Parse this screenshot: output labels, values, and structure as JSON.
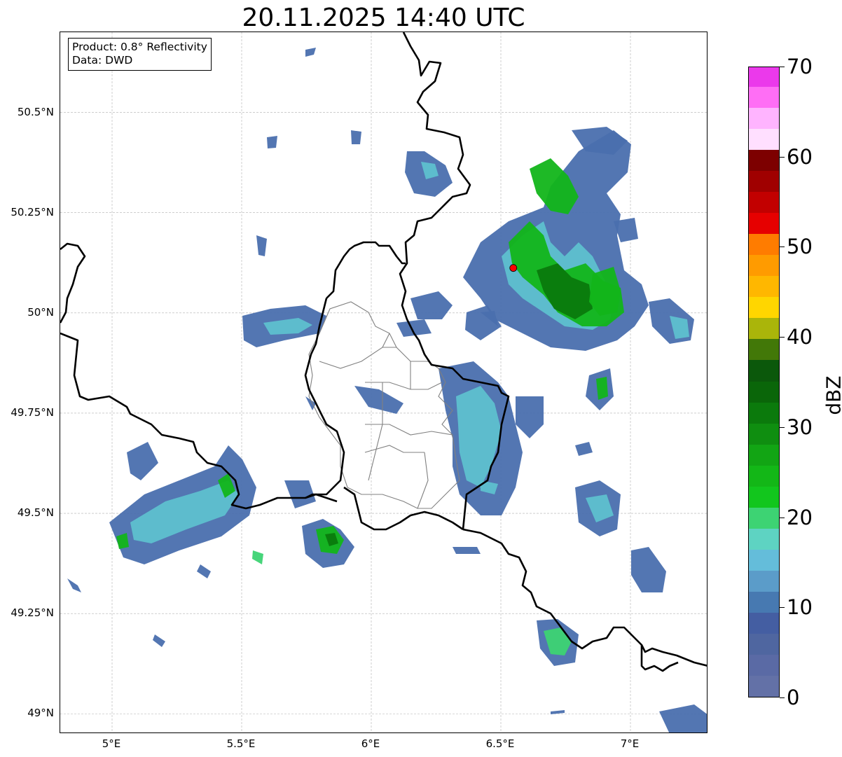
{
  "title": "20.11.2025 14:40 UTC",
  "info": {
    "product": "Product: 0.8° Reflectivity",
    "source": "Data: DWD"
  },
  "lat_labels": [
    "50.5°N",
    "50.25°N",
    "50°N",
    "49.75°N",
    "49.5°N",
    "49.25°N",
    "49°N"
  ],
  "lat_values": [
    50.5,
    50.25,
    50.0,
    49.75,
    49.5,
    49.25,
    49.0
  ],
  "lon_labels": [
    "5°E",
    "5.5°E",
    "6°E",
    "6.5°E",
    "7°E"
  ],
  "lon_values": [
    5.0,
    5.5,
    6.0,
    6.5,
    7.0
  ],
  "extent": {
    "lon_min": 4.8,
    "lon_max": 7.3,
    "lat_min": 48.95,
    "lat_max": 50.7
  },
  "radar_site": {
    "lon": 6.548,
    "lat": 50.112,
    "color": "#ff0000"
  },
  "colorbar": {
    "unit": "dBZ",
    "min": 0,
    "max": 70,
    "step": 2.5,
    "tick_labels": [
      "0",
      "10",
      "20",
      "30",
      "40",
      "50",
      "60",
      "70"
    ],
    "tick_values": [
      0,
      10,
      20,
      30,
      40,
      50,
      60,
      70
    ],
    "colors": [
      "#6371a7",
      "#5a6aa5",
      "#4f66a0",
      "#445ea2",
      "#4779b1",
      "#5b9cc9",
      "#64bdda",
      "#5ed3c2",
      "#3dd373",
      "#12c61d",
      "#13b717",
      "#12a514",
      "#0f8e10",
      "#0b7a0c",
      "#0a6609",
      "#0b580b",
      "#427808",
      "#aab50a",
      "#ffd600",
      "#ffb700",
      "#ff9b00",
      "#ff7c00",
      "#e60000",
      "#c20000",
      "#a00000",
      "#7d0000",
      "#ffdfff",
      "#ffb4ff",
      "#ff6ef5",
      "#eb39eb"
    ]
  },
  "echo_colors": {
    "weak": "#4a6fae",
    "light": "#5ec0cf",
    "moderate": "#3dd373",
    "strong": "#12b51a",
    "core": "#0a7a0d"
  },
  "map_colors": {
    "border": "#000000",
    "district": "#808080",
    "grid": "#b0b0b0"
  }
}
